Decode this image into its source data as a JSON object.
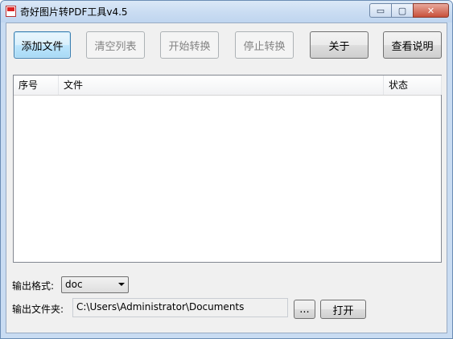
{
  "window": {
    "title": "奇好图片转PDF工具v4.5",
    "min_glyph": "▭",
    "max_glyph": "▢",
    "close_glyph": "✕"
  },
  "toolbar": {
    "add_files": "添加文件",
    "clear_list": "清空列表",
    "start_convert": "开始转换",
    "stop_convert": "停止转换",
    "about": "关于",
    "help": "查看说明"
  },
  "file_list": {
    "columns": [
      "序号",
      "文件",
      "状态"
    ],
    "rows": []
  },
  "output": {
    "format_label": "输出格式:",
    "format_value": "doc",
    "folder_label": "输出文件夹:",
    "folder_path": "C:\\Users\\Administrator\\Documents",
    "browse_label": "...",
    "open_label": "打开"
  },
  "colors": {
    "accent_focus": "#3c7fb1",
    "window_frame": "#c9dcf2",
    "close_button": "#c8503a"
  }
}
